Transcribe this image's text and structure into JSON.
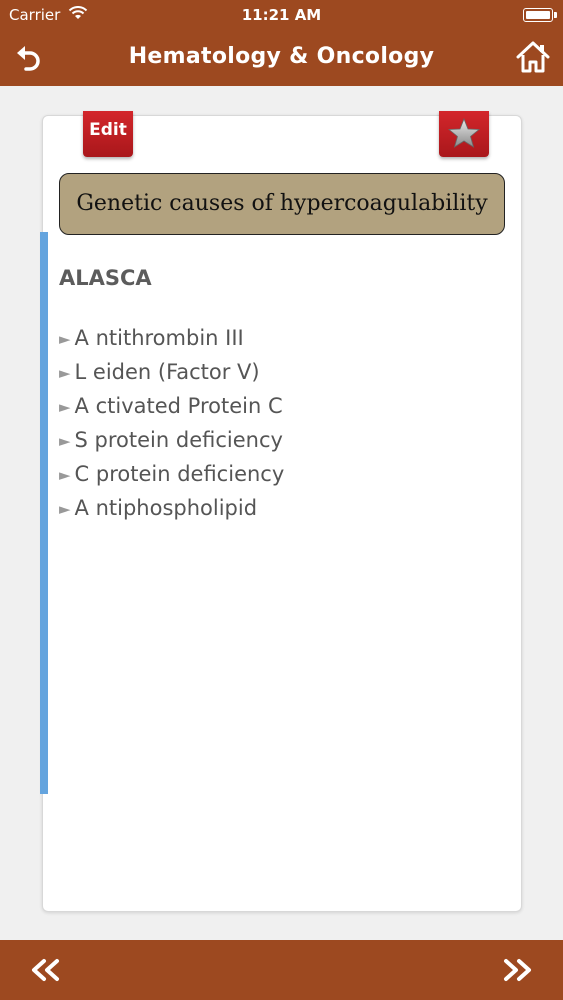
{
  "status": {
    "carrier": "Carrier",
    "time": "11:21 AM"
  },
  "nav": {
    "title": "Hematology & Oncology"
  },
  "card": {
    "edit_label": "Edit",
    "topic": "Genetic causes of hypercoagulability",
    "mnemonic": "ALASCA",
    "items": [
      "A ntithrombin III",
      "L eiden (Factor V)",
      "A ctivated Protein C",
      "S protein deficiency",
      "C protein deficiency",
      "A ntiphospholipid"
    ]
  },
  "colors": {
    "bar": "#9d4920",
    "tab": "#c21f24",
    "topic_bg": "#b2a27f",
    "accent": "#64a4de"
  },
  "icons": {
    "back": "back-arrow-icon",
    "home": "home-icon",
    "favorite": "star-icon",
    "prev": "double-chevron-left-icon",
    "next": "double-chevron-right-icon"
  }
}
